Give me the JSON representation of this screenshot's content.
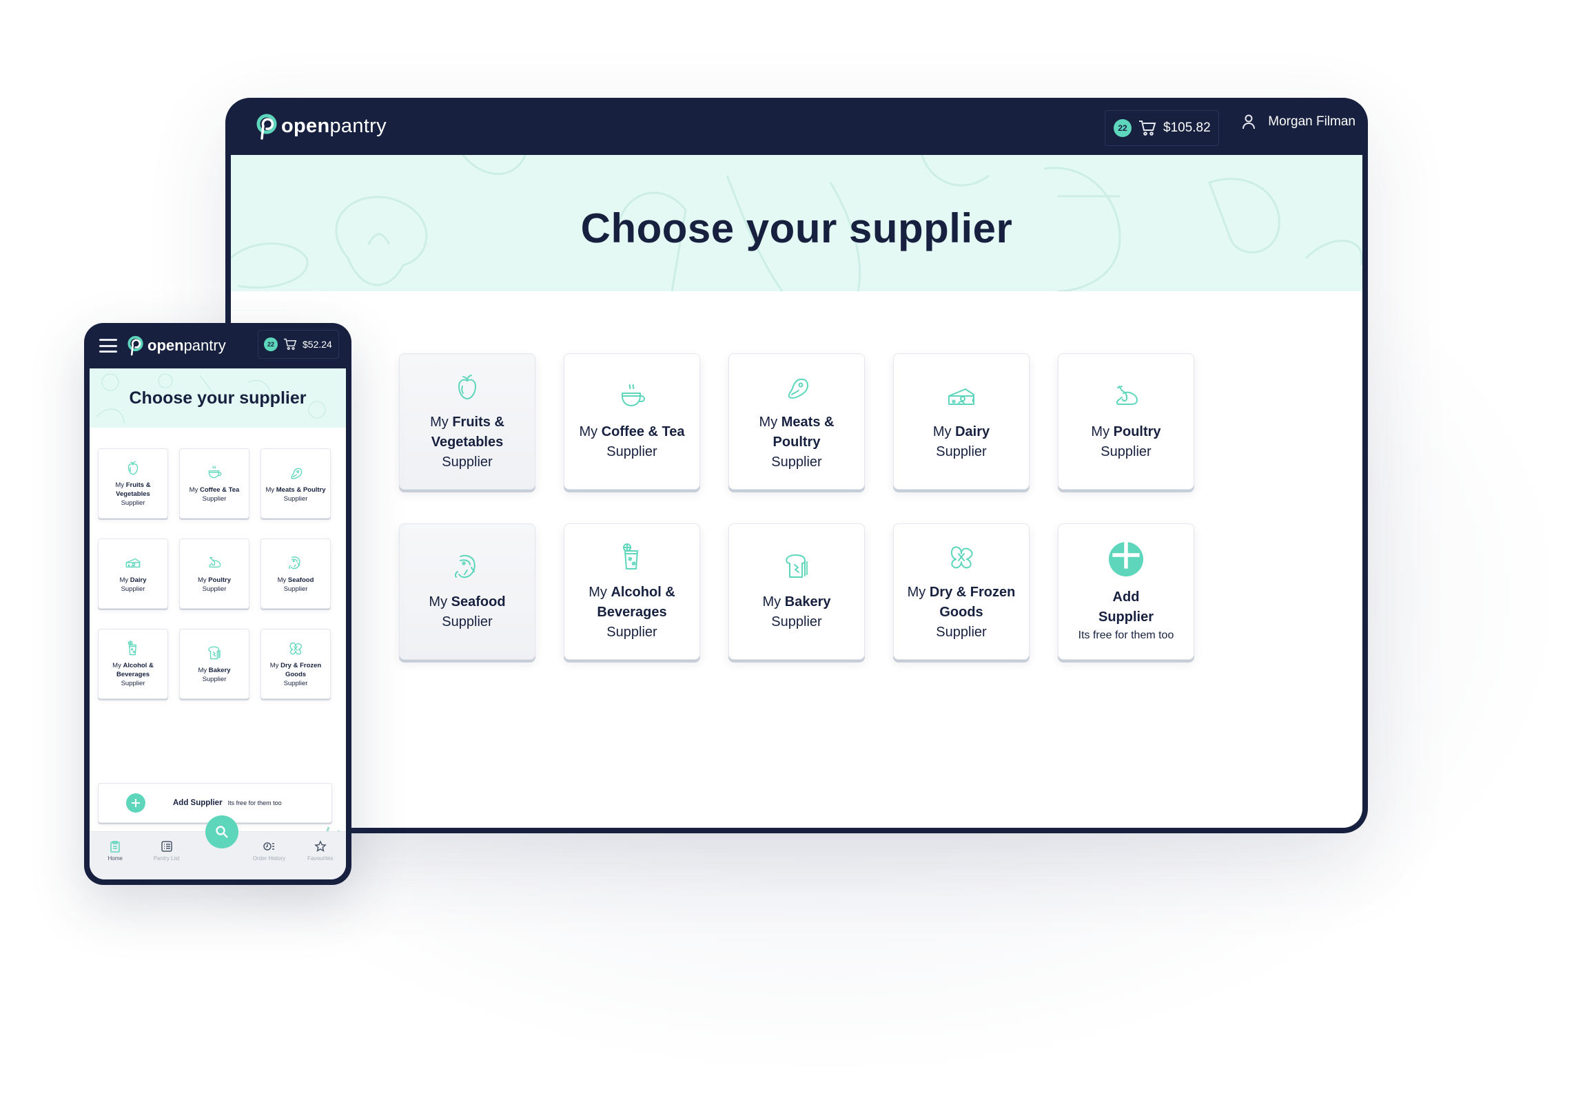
{
  "brand": {
    "name_bold": "open",
    "name_light": "pantry",
    "accent": "#5dd6bc",
    "navy": "#17213f",
    "hero_bg": "#e4f9f4"
  },
  "desktop": {
    "cart": {
      "count": "22",
      "total": "$105.82"
    },
    "user": {
      "name": "Morgan Filman"
    },
    "title": "Choose your supplier",
    "suppliers": [
      {
        "pre": "My",
        "name": "Fruits & Vegetables",
        "suffix": "Supplier",
        "icon": "apple-icon"
      },
      {
        "pre": "My",
        "name": "Coffee & Tea",
        "suffix": "Supplier",
        "icon": "coffee-cup-icon"
      },
      {
        "pre": "My",
        "name": "Meats & Poultry",
        "suffix": "Supplier",
        "icon": "steak-icon"
      },
      {
        "pre": "My",
        "name": "Dairy",
        "suffix": "Supplier",
        "icon": "cheese-icon"
      },
      {
        "pre": "My",
        "name": "Poultry",
        "suffix": "Supplier",
        "icon": "chicken-icon"
      },
      {
        "pre": "My",
        "name": "Seafood",
        "suffix": "Supplier",
        "icon": "shrimp-icon"
      },
      {
        "pre": "My",
        "name": "Alcohol & Beverages",
        "suffix": "Supplier",
        "icon": "drink-icon"
      },
      {
        "pre": "My",
        "name": "Bakery",
        "suffix": "Supplier",
        "icon": "bread-icon"
      },
      {
        "pre": "My",
        "name": "Dry & Frozen Goods",
        "suffix": "Supplier",
        "icon": "pasta-icon"
      }
    ],
    "add_supplier": {
      "title": "Add Supplier",
      "subtitle": "Its free for them too"
    }
  },
  "mobile": {
    "cart": {
      "count": "22",
      "total": "$52.24"
    },
    "title": "Choose your supplier",
    "suppliers": [
      {
        "pre": "My",
        "name": "Fruits & Vegetables",
        "suffix": "Supplier",
        "icon": "apple-icon"
      },
      {
        "pre": "My",
        "name": "Coffee & Tea",
        "suffix": "Supplier",
        "icon": "coffee-cup-icon"
      },
      {
        "pre": "My",
        "name": "Meats & Poultry",
        "suffix": "Supplier",
        "icon": "steak-icon"
      },
      {
        "pre": "My",
        "name": "Dairy",
        "suffix": "Supplier",
        "icon": "cheese-icon"
      },
      {
        "pre": "My",
        "name": "Poultry",
        "suffix": "Supplier",
        "icon": "chicken-icon"
      },
      {
        "pre": "My",
        "name": "Seafood",
        "suffix": "Supplier",
        "icon": "shrimp-icon"
      },
      {
        "pre": "My",
        "name": "Alcohol & Beverages",
        "suffix": "Supplier",
        "icon": "drink-icon"
      },
      {
        "pre": "My",
        "name": "Bakery",
        "suffix": "Supplier",
        "icon": "bread-icon"
      },
      {
        "pre": "My",
        "name": "Dry & Frozen Goods",
        "suffix": "Supplier",
        "icon": "pasta-icon"
      }
    ],
    "add_supplier": {
      "title": "Add Supplier",
      "subtitle": "Its free for them too"
    },
    "nav": [
      {
        "label": "Home",
        "icon": "clipboard-icon",
        "active": true
      },
      {
        "label": "Pantry List",
        "icon": "list-icon",
        "active": false
      },
      {
        "label": "Order History",
        "icon": "clock-list-icon",
        "active": false
      },
      {
        "label": "Favourites",
        "icon": "star-icon",
        "active": false
      }
    ]
  }
}
